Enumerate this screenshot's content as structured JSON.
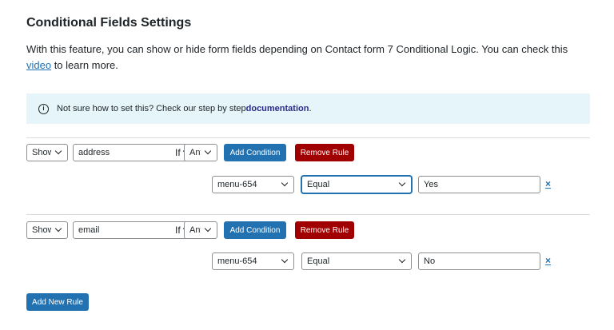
{
  "section": {
    "title": "Conditional Fields Settings",
    "desc_pre": "With this feature, you can show or hide form fields depending on Contact form 7 Conditional Logic. You can check this ",
    "desc_link": "video",
    "desc_post": " to learn more."
  },
  "notice": {
    "icon": "info-icon",
    "text": "Not sure how to set this? Check our step by step ",
    "link": "documentation",
    "suffix": "."
  },
  "rules": [
    {
      "action": "Show",
      "field": "address",
      "if_label": "If",
      "match": "Any",
      "add_condition": "Add Condition",
      "remove_rule": "Remove Rule",
      "condition": {
        "field": "menu-654",
        "operator": "Equal",
        "value": "Yes",
        "remove": "×"
      }
    },
    {
      "action": "Show",
      "field": "email",
      "if_label": "If",
      "match": "Any",
      "add_condition": "Add Condition",
      "remove_rule": "Remove Rule",
      "condition": {
        "field": "menu-654",
        "operator": "Equal",
        "value": "No",
        "remove": "×"
      }
    }
  ],
  "footer": {
    "add_new_rule": "Add New Rule"
  },
  "colors": {
    "primary": "#2271b1",
    "danger": "#a00000",
    "notice_bg": "#e5f5fa"
  }
}
